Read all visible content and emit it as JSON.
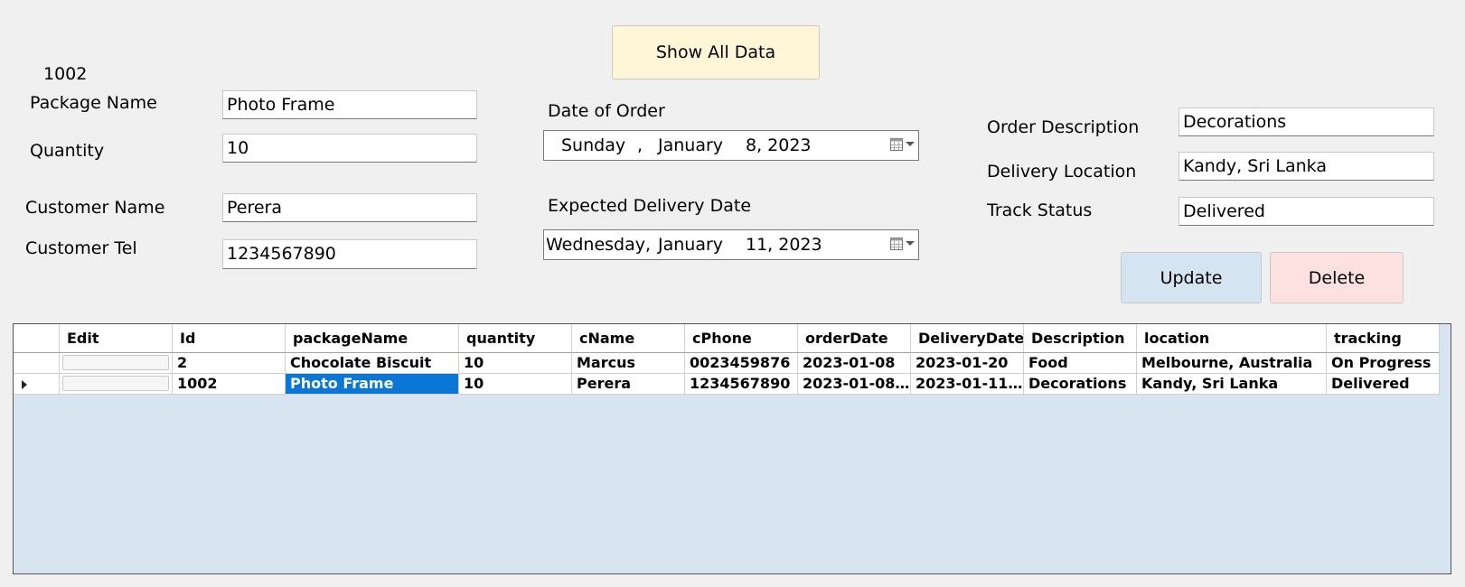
{
  "form": {
    "id_value": "1002",
    "package_name_label": "Package Name",
    "package_name_value": "Photo Frame",
    "quantity_label": "Quantity",
    "quantity_value": "10",
    "customer_name_label": "Customer Name",
    "customer_name_value": "Perera",
    "customer_tel_label": "Customer Tel",
    "customer_tel_value": "1234567890",
    "date_of_order_label": "Date of Order",
    "date_of_order": {
      "weekday": "Sunday",
      "sep": ",",
      "month": "January",
      "day_year": "8, 2023"
    },
    "expected_delivery_label": "Expected Delivery Date",
    "expected_delivery": {
      "weekday": "Wednesday,",
      "month": "January",
      "day_year": "11, 2023"
    },
    "order_description_label": "Order Description",
    "order_description_value": "Decorations",
    "delivery_location_label": "Delivery Location",
    "delivery_location_value": "Kandy, Sri Lanka",
    "track_status_label": "Track Status",
    "track_status_value": "Delivered"
  },
  "buttons": {
    "show_all": "Show All Data",
    "update": "Update",
    "delete": "Delete"
  },
  "colors": {
    "show_all_bg": "#fff6d8",
    "update_bg": "#d6e3f0",
    "delete_bg": "#fde0e0",
    "grid_bg": "#d8e4f0",
    "selected_cell": "#0a76d6"
  },
  "grid": {
    "columns": [
      "Edit",
      "Id",
      "packageName",
      "quantity",
      "cName",
      "cPhone",
      "orderDate",
      "DeliveryDate",
      "Description",
      "location",
      "tracking"
    ],
    "rows": [
      {
        "Id": "2",
        "packageName": "Chocolate Biscuit",
        "quantity": "10",
        "cName": "Marcus",
        "cPhone": "0023459876",
        "orderDate": "2023-01-08",
        "DeliveryDate": "2023-01-20",
        "Description": "Food",
        "location": "Melbourne, Australia",
        "tracking": "On Progress"
      },
      {
        "Id": "1002",
        "packageName": "Photo Frame",
        "quantity": "10",
        "cName": "Perera",
        "cPhone": "1234567890",
        "orderDate": "2023-01-08T0…",
        "DeliveryDate": "2023-01-11T0…",
        "Description": "Decorations",
        "location": "Kandy, Sri Lanka",
        "tracking": "Delivered"
      }
    ]
  }
}
